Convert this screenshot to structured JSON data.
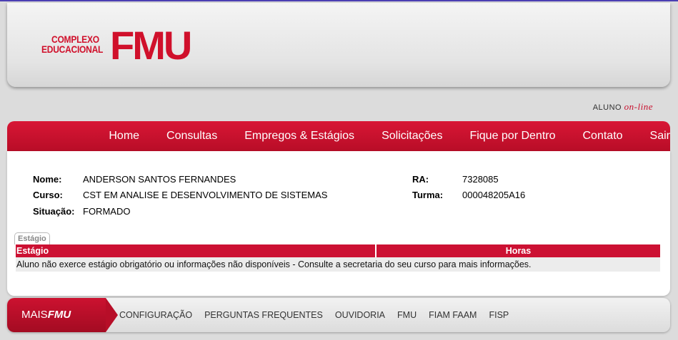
{
  "logo": {
    "small_line1": "COMPLEXO",
    "small_line2": "EDUCACIONAL",
    "big": "FMU"
  },
  "aluno": {
    "prefix": "ALUNO",
    "suffix": "on-line"
  },
  "nav": [
    "Home",
    "Consultas",
    "Empregos & Estágios",
    "Solicitações",
    "Fique por Dentro",
    "Contato",
    "Sair"
  ],
  "student": {
    "nome_label": "Nome:",
    "nome": "ANDERSON SANTOS FERNANDES",
    "curso_label": "Curso:",
    "curso": "CST EM ANALISE E DESENVOLVIMENTO DE SISTEMAS",
    "situacao_label": "Situação:",
    "situacao": "FORMADO",
    "ra_label": "RA:",
    "ra": "7328085",
    "turma_label": "Turma:",
    "turma": "000048205A16"
  },
  "tab": {
    "label": "Estágio"
  },
  "table": {
    "headers": [
      "Estágio",
      "Horas"
    ],
    "message": "Aluno não exerce estágio obrigatório ou informações não disponíveis - Consulte a secretaria do seu curso para mais informações."
  },
  "footer": {
    "mais_prefix": "MAIS",
    "mais_brand": "FMU",
    "links": [
      "CONFIGURAÇÃO",
      "PERGUNTAS FREQUENTES",
      "OUVIDORIA",
      "FMU",
      "FIAM FAAM",
      "FISP"
    ]
  },
  "colors": {
    "brand_red": "#d0102b",
    "nav_red": "#c8102e"
  }
}
